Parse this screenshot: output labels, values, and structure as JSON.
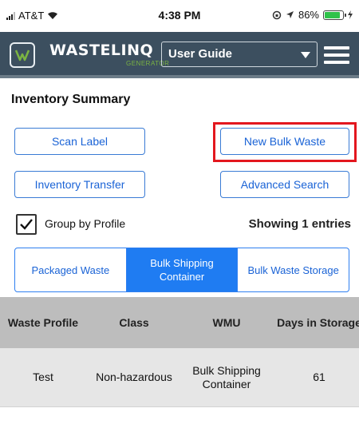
{
  "status_bar": {
    "carrier": "AT&T",
    "time": "4:38 PM",
    "battery": "86%",
    "battery_level": 0.86,
    "battery_color": "#2fc24a"
  },
  "header": {
    "brand": "WASTELINQ",
    "brand_sub": "GENERATOR",
    "guide_select_value": "User Guide",
    "bg_color": "#3c4f5f"
  },
  "page": {
    "title": "Inventory Summary"
  },
  "actions": {
    "scan_label": "Scan Label",
    "new_bulk_waste": "New Bulk Waste",
    "inventory_transfer": "Inventory Transfer",
    "advanced_search": "Advanced Search",
    "highlight_color": "#e3171e"
  },
  "options": {
    "group_by_profile_label": "Group by Profile",
    "group_by_profile_checked": true,
    "showing_text": "Showing 1 entries"
  },
  "tabs": [
    {
      "label": "Packaged Waste",
      "active": false
    },
    {
      "label": "Bulk Shipping Container",
      "active": true
    },
    {
      "label": "Bulk Waste Storage",
      "active": false
    }
  ],
  "table": {
    "columns": [
      "Waste Profile",
      "Class",
      "WMU",
      "Days in Storage"
    ],
    "rows": [
      [
        "Test",
        "Non-hazardous",
        "Bulk Shipping Container",
        "61"
      ]
    ]
  }
}
